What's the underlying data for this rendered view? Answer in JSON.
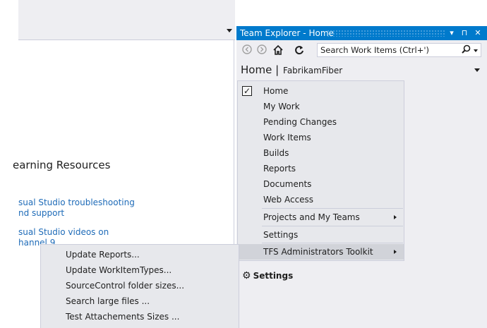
{
  "editor": {
    "learning_heading": "earning Resources",
    "links": [
      {
        "line1": "sual Studio troubleshooting",
        "line2": "nd support"
      },
      {
        "line1": "sual Studio videos on",
        "line2": "hannel 9"
      }
    ]
  },
  "team_explorer": {
    "title": "Team Explorer - Home",
    "title_buttons": [
      "▾",
      "⊓",
      "✕"
    ],
    "toolbar": {
      "back_icon": "back-arrow-icon",
      "forward_icon": "forward-arrow-icon",
      "home_icon": "home-icon",
      "refresh_icon": "refresh-icon"
    },
    "search_placeholder": "Search Work Items (Ctrl+')",
    "page_title": "Home",
    "separator": "|",
    "project": "FabrikamFiber",
    "settings_section": "Settings",
    "accent_color": "#007acc"
  },
  "nav_menu": {
    "items": [
      {
        "label": "Home",
        "checked": true
      },
      {
        "label": "My Work"
      },
      {
        "label": "Pending Changes"
      },
      {
        "label": "Work Items"
      },
      {
        "label": "Builds"
      },
      {
        "label": "Reports"
      },
      {
        "label": "Documents"
      },
      {
        "label": "Web Access"
      },
      {
        "label": "Projects and My Teams",
        "submenu": true
      },
      {
        "label": "Settings"
      },
      {
        "label": "TFS Administrators Toolkit",
        "submenu": true,
        "highlighted": true
      }
    ]
  },
  "sub_menu": {
    "items": [
      {
        "label": "Update Reports..."
      },
      {
        "label": "Update WorkItemTypes..."
      },
      {
        "label": "SourceControl folder sizes..."
      },
      {
        "label": "Search large files ..."
      },
      {
        "label": "Test Attachements Sizes ..."
      }
    ]
  }
}
